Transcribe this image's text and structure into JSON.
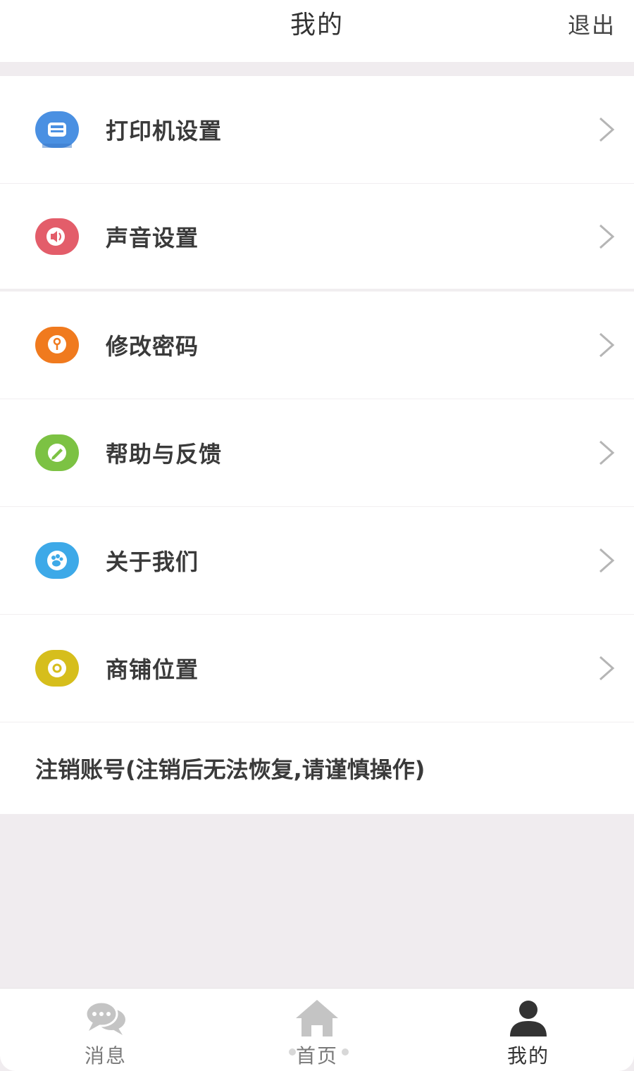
{
  "header": {
    "title": "我的",
    "logout_label": "退出"
  },
  "menu": {
    "items": [
      {
        "label": "打印机设置",
        "icon": "printer-icon",
        "color": "#4a90e2"
      },
      {
        "label": "声音设置",
        "icon": "speaker-icon",
        "color": "#e35d6a"
      },
      {
        "label": "修改密码",
        "icon": "key-icon",
        "color": "#f07a1e"
      },
      {
        "label": "帮助与反馈",
        "icon": "pencil-icon",
        "color": "#7cc243"
      },
      {
        "label": "关于我们",
        "icon": "paw-icon",
        "color": "#3da9e8"
      },
      {
        "label": "商铺位置",
        "icon": "location-pin-icon",
        "color": "#d6be1c"
      }
    ],
    "cancel_account_label": "注销账号(注销后无法恢复,请谨慎操作)"
  },
  "tabbar": {
    "tabs": [
      {
        "label": "消息",
        "icon": "chat-bubbles-icon",
        "active": false
      },
      {
        "label": "首页",
        "icon": "home-icon",
        "active": false
      },
      {
        "label": "我的",
        "icon": "user-icon",
        "active": true
      }
    ]
  },
  "colors": {
    "page_background": "#f0ecef",
    "chevron": "#b5b5b5",
    "tab_inactive": "#c4c4c4",
    "tab_active": "#333333"
  }
}
